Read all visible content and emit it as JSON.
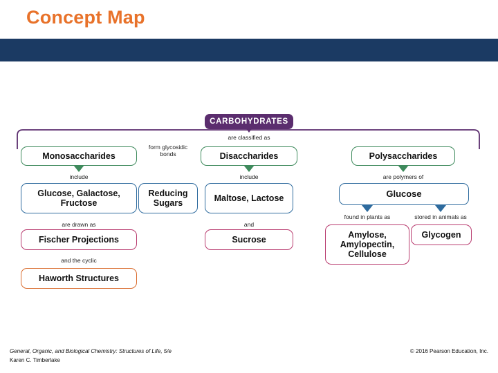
{
  "slide": {
    "title": "Concept Map",
    "accent_orange": "#E8722A",
    "band_navy": "#1B3A63"
  },
  "concept_map": {
    "root": {
      "label": "CARBOHYDRATES",
      "color": "#5B2D6E"
    },
    "branch_caption": "are classified as",
    "nodes": [
      {
        "id": "monosaccharides",
        "label": "Monosaccharides",
        "color": "#3E8A5C"
      },
      {
        "id": "disaccharides",
        "label": "Disaccharides",
        "color": "#3E8A5C"
      },
      {
        "id": "polysaccharides",
        "label": "Polysaccharides",
        "color": "#3E8A5C"
      },
      {
        "id": "glucose-galactose-fructose",
        "label": "Glucose, Galactose, Fructose",
        "color": "#2E6B9E"
      },
      {
        "id": "reducing-sugars",
        "label": "Reducing Sugars",
        "color": "#2E6B9E"
      },
      {
        "id": "maltose-lactose",
        "label": "Maltose, Lactose",
        "color": "#2E6B9E"
      },
      {
        "id": "glucose",
        "label": "Glucose",
        "color": "#2E6B9E"
      },
      {
        "id": "fischer-projections",
        "label": "Fischer Projections",
        "color": "#B83A6E"
      },
      {
        "id": "sucrose",
        "label": "Sucrose",
        "color": "#B83A6E"
      },
      {
        "id": "amylose-amylopectin-cellulose",
        "label": "Amylose, Amylopectin, Cellulose",
        "color": "#B83A6E"
      },
      {
        "id": "glycogen",
        "label": "Glycogen",
        "color": "#B83A6E"
      },
      {
        "id": "haworth-structures",
        "label": "Haworth Structures",
        "color": "#D96A2B"
      }
    ],
    "connector_labels": {
      "mono_include": "include",
      "glycosidic": "form glycosidic bonds",
      "di_include": "include",
      "drawn_as": "are drawn as",
      "and": "and",
      "cyclic": "and the cyclic",
      "polymers_of": "are polymers of",
      "in_plants": "found in plants as",
      "in_animals": "stored in animals as"
    }
  },
  "footer": {
    "book_title": "General, Organic, and Biological Chemistry: Structures of Life, 5/e",
    "author": "Karen C. Timberlake",
    "copyright": "© 2016 Pearson Education, Inc."
  }
}
